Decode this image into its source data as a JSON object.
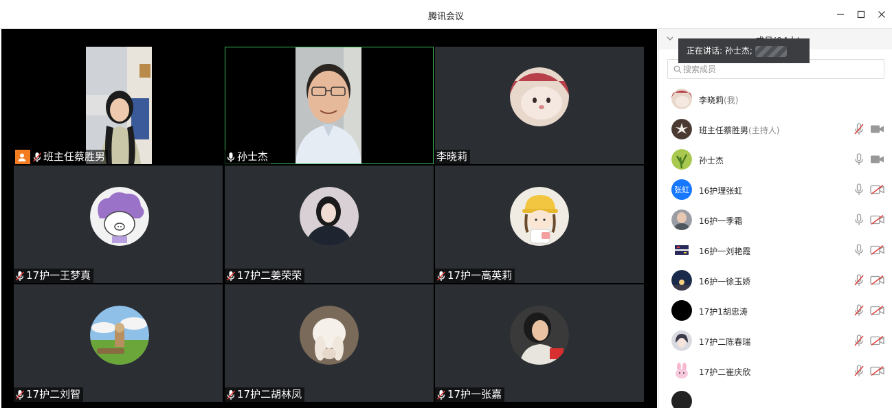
{
  "window": {
    "title": "腾讯会议"
  },
  "panel": {
    "header": "成员(94人)",
    "speaking_label": "正在讲话: 孙士杰;",
    "search_placeholder": "搜索成员",
    "members": [
      {
        "name": "李晓莉",
        "role": "(我)",
        "mic": "none",
        "cam": "none",
        "avatar": "cat"
      },
      {
        "name": "班主任蔡胜男",
        "role": "(主持人)",
        "mic": "muted",
        "cam": "on",
        "avatar": "flower"
      },
      {
        "name": "孙士杰",
        "role": "",
        "mic": "on",
        "cam": "on",
        "avatar": "plant"
      },
      {
        "name": "16护理张虹",
        "role": "",
        "mic": "on",
        "cam": "off",
        "avatar": "text",
        "avatar_text": "张虹",
        "avatar_color": "#1677ff"
      },
      {
        "name": "16护一季霜",
        "role": "",
        "mic": "on",
        "cam": "off",
        "avatar": "photo"
      },
      {
        "name": "16护一刘艳霞",
        "role": "",
        "mic": "on",
        "cam": "off",
        "avatar": "daytoy"
      },
      {
        "name": "16护一徐玉娇",
        "role": "",
        "mic": "muted",
        "cam": "off",
        "avatar": "night"
      },
      {
        "name": "17护1胡忠涛",
        "role": "",
        "mic": "muted",
        "cam": "off",
        "avatar": "black"
      },
      {
        "name": "17护二陈春瑞",
        "role": "",
        "mic": "muted",
        "cam": "off",
        "avatar": "anime"
      },
      {
        "name": "17护二崔庆欣",
        "role": "",
        "mic": "muted",
        "cam": "off",
        "avatar": "bunny"
      }
    ]
  },
  "tiles": [
    {
      "name": "班主任蔡胜男",
      "mic": "muted",
      "host": true,
      "type": "video"
    },
    {
      "name": "孙士杰",
      "mic": "on",
      "host": false,
      "type": "video",
      "speaking": true
    },
    {
      "name": "李晓莉",
      "mic": "none",
      "host": false,
      "type": "avatar"
    },
    {
      "name": "17护一王梦真",
      "mic": "muted",
      "host": false,
      "type": "avatar"
    },
    {
      "name": "17护二姜荣荣",
      "mic": "muted",
      "host": false,
      "type": "avatar"
    },
    {
      "name": "17护一高英莉",
      "mic": "muted",
      "host": false,
      "type": "avatar"
    },
    {
      "name": "17护二刘智",
      "mic": "muted",
      "host": false,
      "type": "avatar"
    },
    {
      "name": "17护二胡林凤",
      "mic": "muted",
      "host": false,
      "type": "avatar"
    },
    {
      "name": "17护一张嘉",
      "mic": "muted",
      "host": false,
      "type": "avatar"
    }
  ],
  "colors": {
    "muted": "#e23a3a",
    "speaking_border": "#3dbd5b",
    "host_badge": "#f47c20",
    "tile_bg": "#2b2e32"
  },
  "icons": [
    "minimize-icon",
    "maximize-icon",
    "close-icon",
    "chevron-down-icon",
    "search-icon",
    "mic-icon",
    "mic-muted-icon",
    "camera-icon",
    "camera-off-icon",
    "host-icon"
  ]
}
